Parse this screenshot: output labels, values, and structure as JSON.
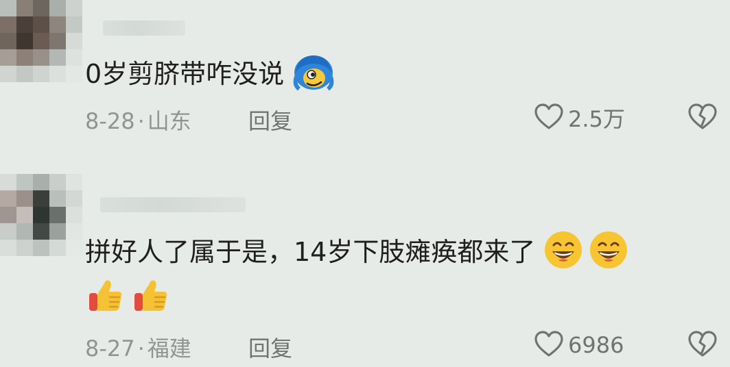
{
  "comments": [
    {
      "text": "0岁剪脐带咋没说",
      "emoji_names": [
        "blue-hair-face-icon"
      ],
      "date": "8-28",
      "location": "山东",
      "dot": "·",
      "reply_label": "回复",
      "like_count": "2.5万"
    },
    {
      "text": "拼好人了属于是，14岁下肢瘫痪都来了",
      "emoji_names": [
        "grin-emoji-icon",
        "grin-emoji-icon",
        "thumbs-up-icon",
        "thumbs-up-icon"
      ],
      "date": "8-27",
      "location": "福建",
      "dot": "·",
      "reply_label": "回复",
      "like_count": "6986"
    }
  ],
  "colors": {
    "background": "#e6ebe7",
    "text": "#1f1f1f",
    "meta": "#8f9592",
    "action": "#6e7471"
  }
}
